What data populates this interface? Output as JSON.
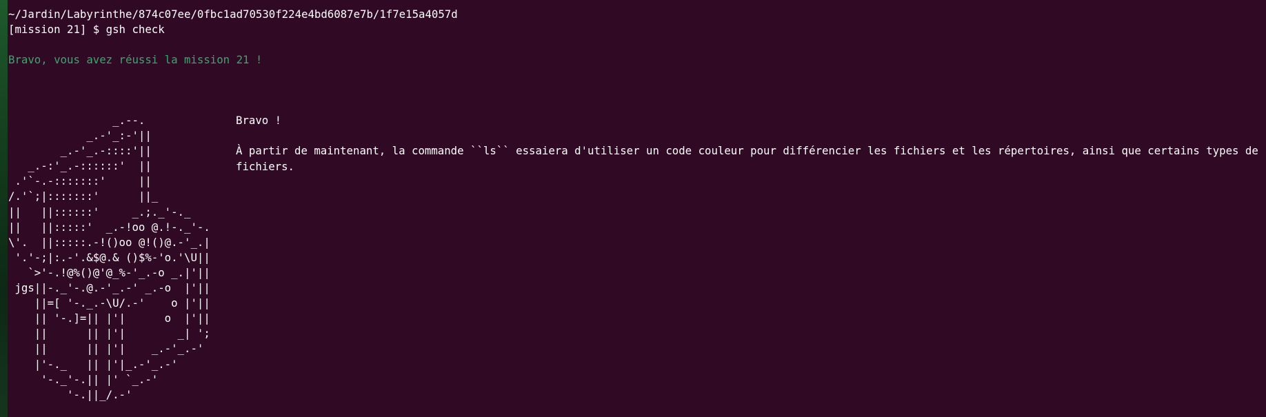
{
  "terminal": {
    "path_line": "~/Jardin/Labyrinthe/874c07ee/0fbc1ad70530f224e4bd6087e7b/1f7e15a4057d",
    "prompt": "[mission 21] $ ",
    "command": "gsh check",
    "success_message": "Bravo, vous avez réussi la mission 21 !",
    "ascii_art": "                _.--.\n            _.-'_:-'||\n        _.-'_.-::::'||\n   _.-:'_.-::::::'  ||\n .'`-.-:::::::'     ||\n/.'`;|:::::::'      ||_\n||   ||::::::'     _.;._'-._\n||   ||:::::'  _.-!oo @.!-._'-.\n\\'.  ||:::::.-!()oo @!()@.-'_.|\n '.'-;|:.-'.&$@.& ()$%-'o.'\\U||\n   `>'-.!@%()@'@_%-'_.-o _.|'||\n jgs||-._'-.@.-'_.-' _.-o  |'||\n    ||=[ '-._.-\\U/.-'    o |'||\n    || '-.]=|| |'|      o  |'||\n    ||      || |'|        _| ';\n    ||      || |'|    _.-'_.-'\n    |'-._   || |'|_.-'_.-'\n     '-._'-.|| |' `_.-'\n         '-.||_/.-'",
    "message_title": "Bravo !",
    "message_body": "À partir de maintenant, la commande ``ls`` essaiera d'utiliser un code couleur pour différencier les fichiers et les répertoires, ainsi que certains types de fichiers."
  },
  "colors": {
    "background": "#300a24",
    "text": "#ffffff",
    "success": "#3aa76d"
  }
}
